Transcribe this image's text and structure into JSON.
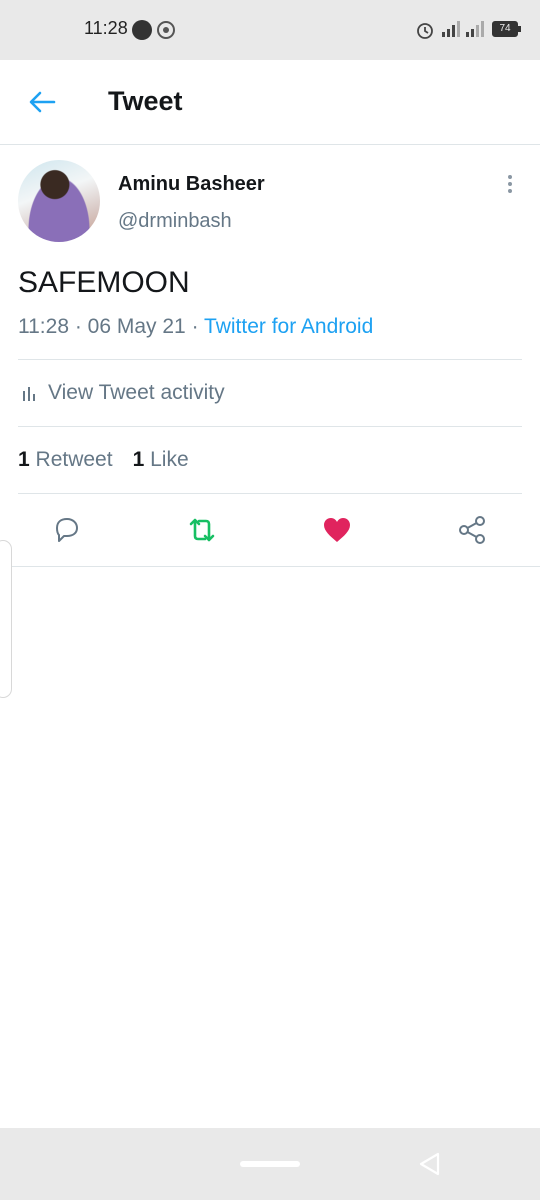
{
  "status_bar": {
    "time": "11:28",
    "battery": "74"
  },
  "header": {
    "title": "Tweet"
  },
  "tweet": {
    "author_name": "Aminu Basheer",
    "author_handle": "@drminbash",
    "text": "SAFEMOON",
    "time": "11:28",
    "date": "06 May 21",
    "separator": " · ",
    "source": "Twitter for Android"
  },
  "activity": {
    "label": "View Tweet activity"
  },
  "stats": {
    "retweets_count": "1",
    "retweets_label": "Retweet",
    "likes_count": "1",
    "likes_label": "Like"
  },
  "colors": {
    "accent": "#1da1f2",
    "retweet": "#17bf63",
    "like": "#e0245e",
    "secondary_text": "#657786"
  },
  "icons": {
    "back": "arrow-left-icon",
    "more": "more-vertical-icon",
    "reply": "reply-icon",
    "retweet": "retweet-icon",
    "like": "heart-icon",
    "share": "share-icon"
  }
}
